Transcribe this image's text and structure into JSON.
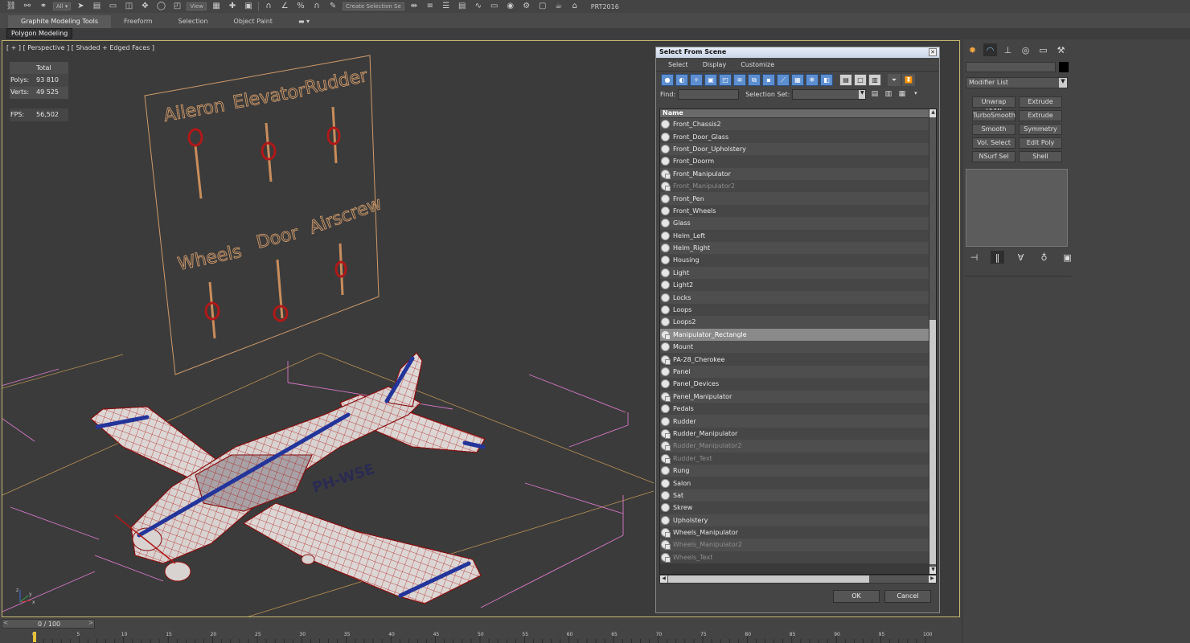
{
  "toolbar": {
    "view_label": "View",
    "selection_set_placeholder": "Create Selection Se",
    "prt_label": "PRT2016",
    "icons": [
      "link-icon",
      "unlink-icon",
      "bind-icon",
      "select-filter-icon",
      "select-icon",
      "region-icon",
      "circle-region-icon",
      "select-by-name-icon",
      "move-icon",
      "rotate-icon",
      "scale-icon",
      "view-icon",
      "pivot-icon",
      "snap-icon",
      "angle-snap-icon",
      "percent-snap-icon",
      "spinner-snap-icon",
      "named-set-icon",
      "mirror-icon",
      "align-icon",
      "layers-icon",
      "graphite-icon",
      "curve-editor-icon",
      "schematic-icon",
      "material-icon",
      "render-setup-icon",
      "render-frame-icon",
      "render-icon",
      "teapot-icon"
    ]
  },
  "ribbon": {
    "tabs": [
      "Graphite Modeling Tools",
      "Freeform",
      "Selection",
      "Object Paint"
    ],
    "active_tab": 0,
    "panel_button": "Polygon Modeling"
  },
  "viewport": {
    "label": "[ + ] [ Perspective ] [ Shaded + Edged Faces ]",
    "stats_header": "Total",
    "stats": [
      {
        "label": "Polys:",
        "value": "93 810"
      },
      {
        "label": "Verts:",
        "value": "49 525"
      }
    ],
    "fps_label": "FPS:",
    "fps_value": "56,502",
    "panel_labels": [
      "Aileron",
      "Elevator",
      "Rudder",
      "Wheels",
      "Door",
      "Airscrew"
    ],
    "aircraft_registration": "PH-WSE",
    "axis_labels": [
      "z",
      "x",
      "y"
    ]
  },
  "dialog": {
    "title": "Select From Scene",
    "menu": [
      "Select",
      "Display",
      "Customize"
    ],
    "find_label": "Find:",
    "selection_set_label": "Selection Set:",
    "column_header": "Name",
    "rows": [
      {
        "name": "Front_Chassis2",
        "icon": "sphere",
        "dim": false,
        "selected": false
      },
      {
        "name": "Front_Door_Glass",
        "icon": "sphere",
        "dim": false,
        "selected": false
      },
      {
        "name": "Front_Door_Upholstery",
        "icon": "sphere",
        "dim": false,
        "selected": false
      },
      {
        "name": "Front_Doorm",
        "icon": "sphere",
        "dim": false,
        "selected": false
      },
      {
        "name": "Front_Manipulator",
        "icon": "helper",
        "dim": false,
        "selected": false
      },
      {
        "name": "Front_Manipulator2",
        "icon": "helper",
        "dim": true,
        "selected": false
      },
      {
        "name": "Front_Pen",
        "icon": "sphere",
        "dim": false,
        "selected": false
      },
      {
        "name": "Front_Wheels",
        "icon": "sphere",
        "dim": false,
        "selected": false
      },
      {
        "name": "Glass",
        "icon": "sphere",
        "dim": false,
        "selected": false
      },
      {
        "name": "Helm_Left",
        "icon": "sphere",
        "dim": false,
        "selected": false
      },
      {
        "name": "Helm_Right",
        "icon": "sphere",
        "dim": false,
        "selected": false
      },
      {
        "name": "Housing",
        "icon": "sphere",
        "dim": false,
        "selected": false
      },
      {
        "name": "Light",
        "icon": "sphere",
        "dim": false,
        "selected": false
      },
      {
        "name": "Light2",
        "icon": "sphere",
        "dim": false,
        "selected": false
      },
      {
        "name": "Locks",
        "icon": "sphere",
        "dim": false,
        "selected": false
      },
      {
        "name": "Loops",
        "icon": "sphere",
        "dim": false,
        "selected": false
      },
      {
        "name": "Loops2",
        "icon": "sphere",
        "dim": false,
        "selected": false
      },
      {
        "name": "Manipulator_Rectangle",
        "icon": "helper",
        "dim": false,
        "selected": true
      },
      {
        "name": "Mount",
        "icon": "sphere",
        "dim": false,
        "selected": false
      },
      {
        "name": "PA-28_Cherokee",
        "icon": "helper",
        "dim": false,
        "selected": false
      },
      {
        "name": "Panel",
        "icon": "sphere",
        "dim": false,
        "selected": false
      },
      {
        "name": "Panel_Devices",
        "icon": "sphere",
        "dim": false,
        "selected": false
      },
      {
        "name": "Panel_Manipulator",
        "icon": "helper",
        "dim": false,
        "selected": false
      },
      {
        "name": "Pedals",
        "icon": "sphere",
        "dim": false,
        "selected": false
      },
      {
        "name": "Rudder",
        "icon": "sphere",
        "dim": false,
        "selected": false
      },
      {
        "name": "Rudder_Manipulator",
        "icon": "helper",
        "dim": false,
        "selected": false
      },
      {
        "name": "Rudder_Manipulator2",
        "icon": "helper",
        "dim": true,
        "selected": false
      },
      {
        "name": "Rudder_Text",
        "icon": "helper",
        "dim": true,
        "selected": false
      },
      {
        "name": "Rung",
        "icon": "sphere",
        "dim": false,
        "selected": false
      },
      {
        "name": "Salon",
        "icon": "sphere",
        "dim": false,
        "selected": false
      },
      {
        "name": "Sat",
        "icon": "sphere",
        "dim": false,
        "selected": false
      },
      {
        "name": "Skrew",
        "icon": "sphere",
        "dim": false,
        "selected": false
      },
      {
        "name": "Upholstery",
        "icon": "sphere",
        "dim": false,
        "selected": false
      },
      {
        "name": "Wheels_Manipulator",
        "icon": "helper",
        "dim": false,
        "selected": false
      },
      {
        "name": "Wheels_Manipulator2",
        "icon": "helper",
        "dim": true,
        "selected": false
      },
      {
        "name": "Wheels_Text",
        "icon": "helper",
        "dim": true,
        "selected": false
      }
    ],
    "ok_label": "OK",
    "cancel_label": "Cancel"
  },
  "command_panel": {
    "modifier_list_label": "Modifier List",
    "modifier_buttons": [
      "Unwrap UVW",
      "Extrude",
      "TurboSmooth",
      "Extrude",
      "Smooth",
      "Symmetry",
      "Vol. Select",
      "Edit Poly",
      "NSurf Sel",
      "Shell"
    ],
    "tab_icons": [
      "create-icon",
      "modify-icon",
      "hierarchy-icon",
      "motion-icon",
      "display-icon",
      "utilities-icon"
    ]
  },
  "timeline": {
    "frame_label": "0 / 100",
    "ticks": [
      0,
      5,
      10,
      15,
      20,
      25,
      30,
      35,
      40,
      45,
      50,
      55,
      60,
      65,
      70,
      75,
      80,
      85,
      90,
      95,
      100
    ]
  },
  "colors": {
    "wireframe": "#b01818",
    "panel_outline": "#d09a6a",
    "helper_box": "#d878c8",
    "grid": "#c69a55",
    "stats_text": "#e4d84e",
    "viewport_border": "#c5b66f",
    "selection_blue": "#5d8fd0"
  }
}
